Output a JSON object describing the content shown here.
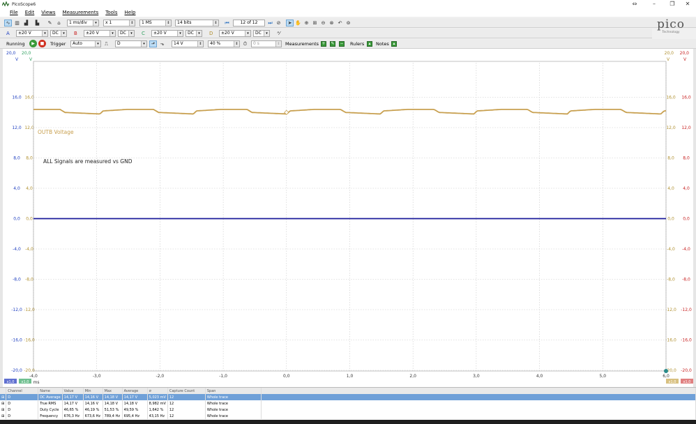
{
  "app": {
    "title": "PicoScope6"
  },
  "menu": [
    "File",
    "Edit",
    "Views",
    "Measurements",
    "Tools",
    "Help"
  ],
  "toolbar1": {
    "timebase": "1 ms/div",
    "multiplier": "x 1",
    "samples": "1 MS",
    "resolution": "14 bits",
    "capture": "12 of 12"
  },
  "channels": [
    {
      "label": "A",
      "range": "±20 V",
      "coupling": "DC"
    },
    {
      "label": "B",
      "range": "±20 V",
      "coupling": "DC"
    },
    {
      "label": "C",
      "range": "±20 V",
      "coupling": "DC"
    },
    {
      "label": "D",
      "range": "±20 V",
      "coupling": "DC"
    }
  ],
  "toolbar3": {
    "status": "Running",
    "trigger_label": "Trigger",
    "trigger_mode": "Auto",
    "trigger_source": "D",
    "trigger_level": "14 V",
    "pretrigger": "40 %",
    "delay": "0 s",
    "measurements_label": "Measurements",
    "rulers_label": "Rulers",
    "notes_label": "Notes"
  },
  "logo": {
    "brand": "pico",
    "sub": "Technology"
  },
  "axes": {
    "left_units": "V",
    "right_units": "V",
    "left_top_a": "20,0",
    "left_top_b": "20,0",
    "right_top_a": "20,0",
    "right_top_b": "20,0",
    "y_ticks": [
      "16,0",
      "12,0",
      "8,0",
      "4,0",
      "0,0",
      "-4,0",
      "-8,0",
      "-12,0",
      "-16,0",
      "-20,0"
    ],
    "x_ticks": [
      "-4,0",
      "-3,0",
      "-2,0",
      "-1,0",
      "0,0",
      "1,0",
      "2,0",
      "3,0",
      "4,0",
      "5,0",
      "6,0"
    ],
    "x_unit": "ms",
    "bottom_left_badges": [
      "x1,0",
      "x1,0"
    ],
    "bottom_right_badges": [
      "x1,0",
      "x1,0"
    ]
  },
  "annotations": {
    "trace_label": "OUTB Voltage",
    "note": "ALL Signals are measured vs GND"
  },
  "colors": {
    "trace_outb": "#c8a050",
    "trace_zero": "#1a1a9a",
    "grid": "#c8c8c8",
    "ch_a": "#2040c0",
    "ch_b": "#c82020",
    "ch_c": "#30a060",
    "ch_d": "#b09030"
  },
  "measurements": {
    "headers": [
      "",
      "Channel",
      "Name",
      "Value",
      "Min",
      "Max",
      "Average",
      "σ",
      "Capture Count",
      "Span"
    ],
    "rows": [
      [
        "",
        "D",
        "DC Average",
        "14,17 V",
        "14,16 V",
        "14,18 V",
        "14,17 V",
        "5,023 mV",
        "12",
        "Whole trace"
      ],
      [
        "",
        "D",
        "True RMS",
        "14,17 V",
        "14,16 V",
        "14,18 V",
        "14,18 V",
        "8,982 mV",
        "12",
        "Whole trace"
      ],
      [
        "",
        "D",
        "Duty Cycle",
        "46,65 %",
        "46,19 %",
        "51,53 %",
        "49,59 %",
        "1,642 %",
        "12",
        "Whole trace"
      ],
      [
        "",
        "D",
        "Frequency",
        "676,3 Hz",
        "673,6 Hz",
        "789,4 Hz",
        "695,4 Hz",
        "43,15 Hz",
        "12",
        "Whole trace"
      ]
    ]
  }
}
